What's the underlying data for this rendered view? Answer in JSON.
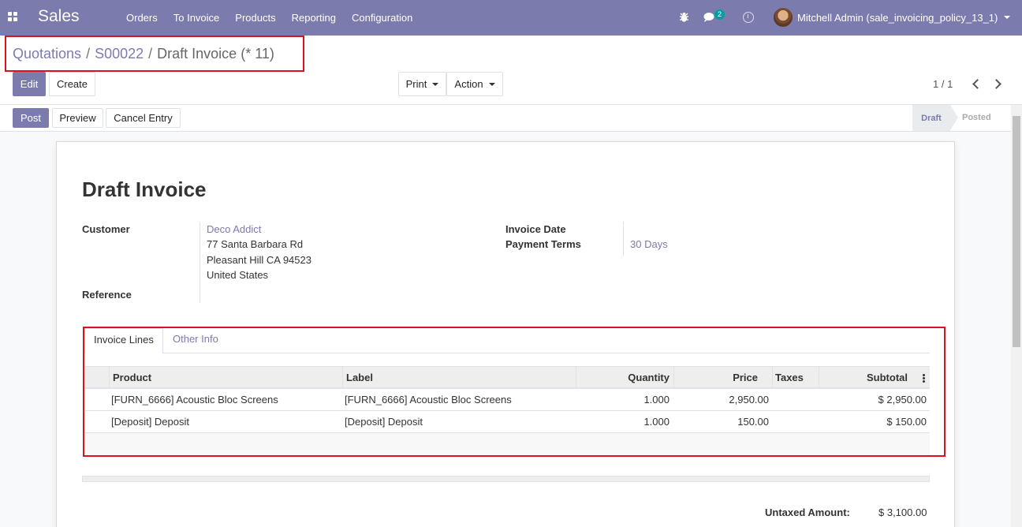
{
  "navbar": {
    "app_name": "Sales",
    "menu": [
      "Orders",
      "To Invoice",
      "Products",
      "Reporting",
      "Configuration"
    ],
    "chat_count": "2",
    "user": "Mitchell Admin (sale_invoicing_policy_13_1)",
    "color": "#7c7bad"
  },
  "breadcrumb": {
    "items": [
      "Quotations",
      "S00022"
    ],
    "current": "Draft Invoice (* 11)"
  },
  "buttons": {
    "edit": "Edit",
    "create": "Create",
    "print": "Print",
    "action": "Action",
    "post": "Post",
    "preview": "Preview",
    "cancel_entry": "Cancel Entry"
  },
  "pager": {
    "value": "1 / 1"
  },
  "status": {
    "draft": "Draft",
    "posted": "Posted"
  },
  "invoice": {
    "title": "Draft Invoice",
    "customer_label": "Customer",
    "customer_name": "Deco Addict",
    "address": [
      "77 Santa Barbara Rd",
      "Pleasant Hill CA 94523",
      "United States"
    ],
    "reference_label": "Reference",
    "invoice_date_label": "Invoice Date",
    "payment_terms_label": "Payment Terms",
    "payment_terms": "30 Days"
  },
  "tabs": [
    "Invoice Lines",
    "Other Info"
  ],
  "lines": {
    "headers": [
      "Product",
      "Label",
      "Quantity",
      "Price",
      "Taxes",
      "Subtotal"
    ],
    "rows": [
      {
        "product": "[FURN_6666] Acoustic Bloc Screens",
        "label": "[FURN_6666] Acoustic Bloc Screens",
        "quantity": "1.000",
        "price": "2,950.00",
        "taxes": "",
        "subtotal": "$ 2,950.00"
      },
      {
        "product": "[Deposit] Deposit",
        "label": "[Deposit] Deposit",
        "quantity": "1.000",
        "price": "150.00",
        "taxes": "",
        "subtotal": "$ 150.00"
      }
    ]
  },
  "totals": {
    "untaxed_label": "Untaxed Amount:",
    "untaxed_value": "$ 3,100.00"
  }
}
